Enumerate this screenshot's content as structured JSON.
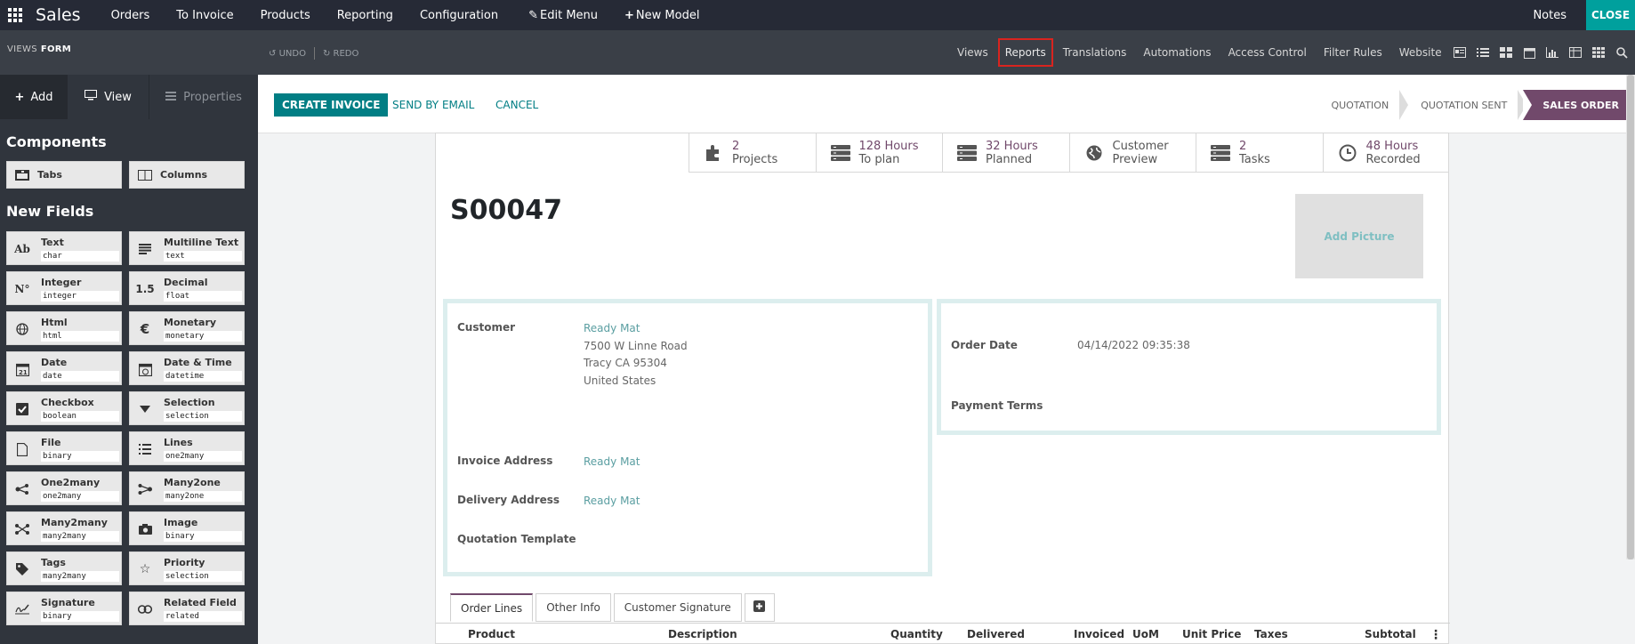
{
  "topbar": {
    "app_title": "Sales",
    "menu": [
      "Orders",
      "To Invoice",
      "Products",
      "Reporting",
      "Configuration"
    ],
    "edit_menu": "Edit Menu",
    "new_model": "New Model",
    "notes": "Notes",
    "close": "CLOSE"
  },
  "subbar": {
    "views_label": "VIEWS",
    "current_view": "FORM",
    "undo": "UNDO",
    "redo": "REDO",
    "tabs": [
      "Views",
      "Reports",
      "Translations",
      "Automations",
      "Access Control",
      "Filter Rules",
      "Website"
    ],
    "active_tab": "Reports"
  },
  "sidebar": {
    "tabs": {
      "add": "Add",
      "view": "View",
      "properties": "Properties"
    },
    "components_heading": "Components",
    "components": [
      {
        "label": "Tabs",
        "icon": "tabs-icon"
      },
      {
        "label": "Columns",
        "icon": "columns-icon"
      }
    ],
    "fields_heading": "New Fields",
    "fields": [
      {
        "label": "Text",
        "type": "char",
        "icon": "Ab"
      },
      {
        "label": "Multiline Text",
        "type": "text",
        "icon": "lines"
      },
      {
        "label": "Integer",
        "type": "integer",
        "icon": "N°"
      },
      {
        "label": "Decimal",
        "type": "float",
        "icon": "1.5"
      },
      {
        "label": "Html",
        "type": "html",
        "icon": "globe"
      },
      {
        "label": "Monetary",
        "type": "monetary",
        "icon": "€"
      },
      {
        "label": "Date",
        "type": "date",
        "icon": "calendar"
      },
      {
        "label": "Date & Time",
        "type": "datetime",
        "icon": "calendar-clock"
      },
      {
        "label": "Checkbox",
        "type": "boolean",
        "icon": "checkbox"
      },
      {
        "label": "Selection",
        "type": "selection",
        "icon": "caret"
      },
      {
        "label": "File",
        "type": "binary",
        "icon": "file"
      },
      {
        "label": "Lines",
        "type": "one2many",
        "icon": "list"
      },
      {
        "label": "One2many",
        "type": "one2many",
        "icon": "share"
      },
      {
        "label": "Many2one",
        "type": "many2one",
        "icon": "branch"
      },
      {
        "label": "Many2many",
        "type": "many2many",
        "icon": "shuffle"
      },
      {
        "label": "Image",
        "type": "binary",
        "icon": "camera"
      },
      {
        "label": "Tags",
        "type": "many2many",
        "icon": "tag"
      },
      {
        "label": "Priority",
        "type": "selection",
        "icon": "star"
      },
      {
        "label": "Signature",
        "type": "binary",
        "icon": "signature"
      },
      {
        "label": "Related Field",
        "type": "related",
        "icon": "link"
      }
    ]
  },
  "actions": {
    "create_invoice": "CREATE INVOICE",
    "send_by_email": "SEND BY EMAIL",
    "cancel": "CANCEL"
  },
  "stages": [
    "QUOTATION",
    "QUOTATION SENT",
    "SALES ORDER"
  ],
  "active_stage": "SALES ORDER",
  "smart_buttons": [
    {
      "value": "2",
      "label": "Projects",
      "icon": "puzzle-icon"
    },
    {
      "value": "128 Hours",
      "label": "To plan",
      "icon": "tasks-icon"
    },
    {
      "value": "32 Hours",
      "label": "Planned",
      "icon": "tasks-icon"
    },
    {
      "value": "Customer",
      "label": "Preview",
      "icon": "globe-icon"
    },
    {
      "value": "2",
      "label": "Tasks",
      "icon": "tasks-icon"
    },
    {
      "value": "48 Hours",
      "label": "Recorded",
      "icon": "clock-icon"
    }
  ],
  "record": {
    "name": "S00047",
    "add_picture": "Add Picture",
    "customer_label": "Customer",
    "customer": "Ready Mat",
    "address_line1": "7500 W Linne Road",
    "address_line2": "Tracy CA 95304",
    "address_line3": "United States",
    "invoice_address_label": "Invoice Address",
    "invoice_address": "Ready Mat",
    "delivery_address_label": "Delivery Address",
    "delivery_address": "Ready Mat",
    "quotation_template_label": "Quotation Template",
    "order_date_label": "Order Date",
    "order_date": "04/14/2022 09:35:38",
    "payment_terms_label": "Payment Terms"
  },
  "notebook": {
    "tabs": [
      "Order Lines",
      "Other Info",
      "Customer Signature"
    ],
    "active": "Order Lines"
  },
  "order_lines_columns": [
    "Product",
    "Description",
    "Quantity",
    "Delivered",
    "Invoiced",
    "UoM",
    "Unit Price",
    "Taxes",
    "Subtotal"
  ],
  "colors": {
    "topbar": "#262a36",
    "accent_teal": "#017e84",
    "close_teal": "#00a09d",
    "brand_purple": "#71496b",
    "highlight_red": "#d9241f"
  }
}
